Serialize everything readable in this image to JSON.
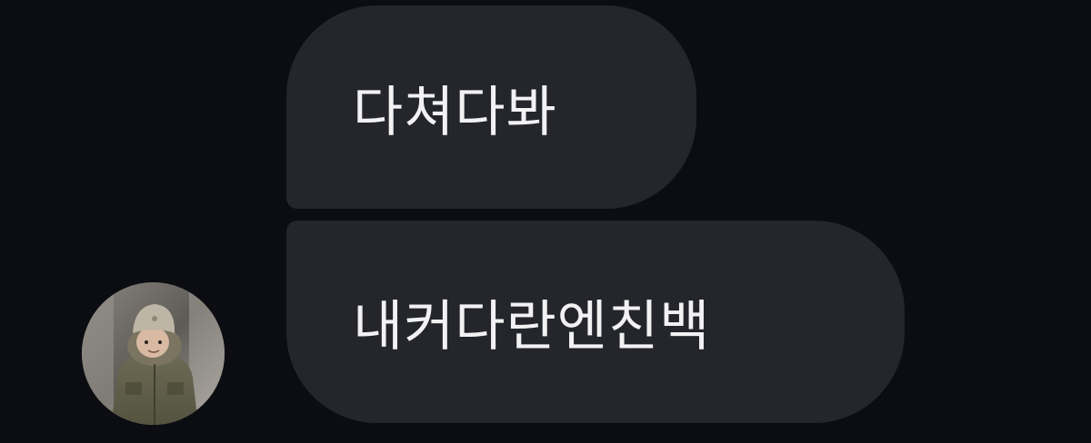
{
  "chat": {
    "messages": [
      {
        "text": "다쳐다봐"
      },
      {
        "text": "내커다란엔친백"
      }
    ]
  },
  "colors": {
    "background": "#0c0d12",
    "bubble": "#24262b",
    "bubble_text": "#f2f2f4"
  },
  "icons": {
    "avatar": "child-profile-photo"
  }
}
